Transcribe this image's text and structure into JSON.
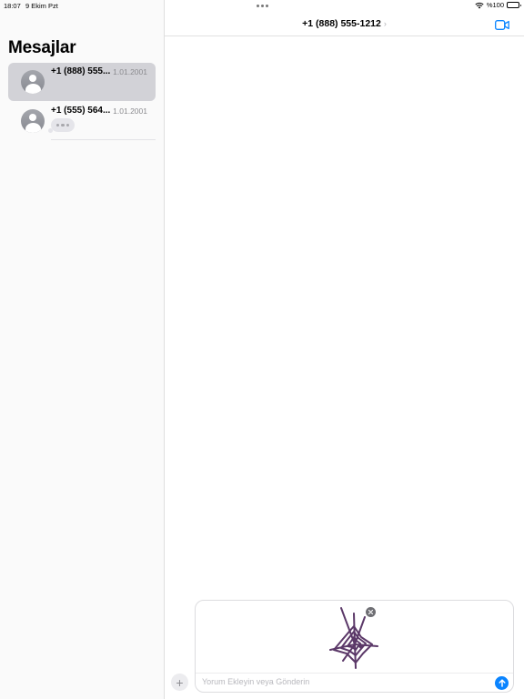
{
  "status_bar": {
    "time": "18:07",
    "date": "9 Ekim Pzt",
    "battery": "%100",
    "icons": [
      "wifi-icon",
      "battery-icon"
    ]
  },
  "sidebar": {
    "title": "Mesajlar",
    "conversations": [
      {
        "name": "+1 (888) 555...",
        "date": "1.01.2001",
        "selected": true,
        "icon": "person-icon"
      },
      {
        "name": "+1 (555) 564...",
        "date": "1.01.2001",
        "selected": false,
        "preview": "typing-indicator",
        "icon": "person-icon"
      }
    ]
  },
  "conversation": {
    "title": "+1 (888) 555-1212",
    "title_icon": "chevron-right-icon",
    "video_icon": "video-camera-icon"
  },
  "composer": {
    "attachment": "spider-web-sticker",
    "placeholder": "Yorum Ekleyin veya Gönderin",
    "value": "",
    "icons": [
      "plus-icon",
      "send-arrow-icon",
      "remove-x-icon"
    ]
  },
  "colors": {
    "accent": "#0a84ff",
    "selected_row": "#d2d2d7",
    "sticker": "#5b3868"
  }
}
